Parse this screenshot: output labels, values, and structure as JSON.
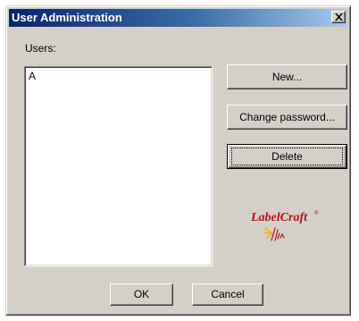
{
  "window": {
    "title": "User Administration"
  },
  "users": {
    "label": "Users:",
    "items": [
      "A"
    ]
  },
  "buttons": {
    "new": "New...",
    "change_password": "Change password...",
    "delete": "Delete",
    "ok": "OK",
    "cancel": "Cancel"
  },
  "logo": {
    "text": "LabelCraft",
    "mark": "®"
  },
  "colors": {
    "titlebar_start": "#0a246a",
    "titlebar_end": "#a6caf0",
    "dialog_face": "#d4d0c8",
    "logo_red": "#b3121a",
    "logo_yellow": "#e8b400"
  },
  "icons": {
    "close": "close-icon"
  }
}
